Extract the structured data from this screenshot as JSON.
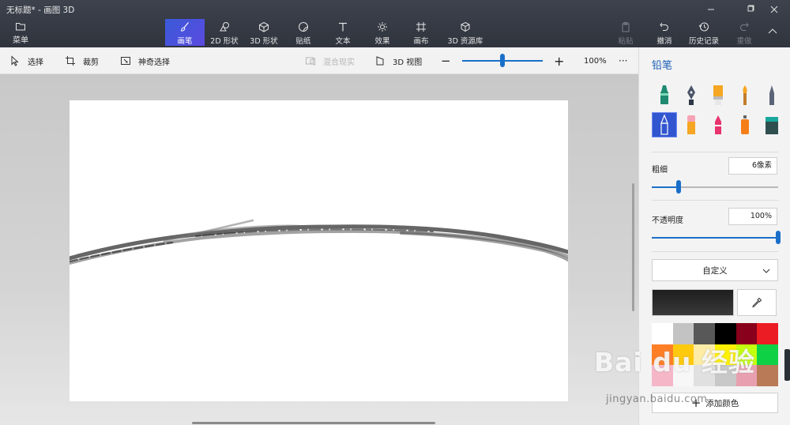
{
  "window": {
    "title": "无标题* - 画图 3D",
    "controls": {
      "minimize": "—",
      "restore": "▫",
      "close": "✕"
    }
  },
  "menu": {
    "label": "菜单",
    "icon": "folder-icon"
  },
  "tools": [
    {
      "label": "画笔",
      "icon": "brush-icon",
      "active": true
    },
    {
      "label": "2D 形状",
      "icon": "2d-shapes-icon",
      "active": false
    },
    {
      "label": "3D 形状",
      "icon": "3d-shapes-icon",
      "active": false
    },
    {
      "label": "贴纸",
      "icon": "sticker-icon",
      "active": false
    },
    {
      "label": "文本",
      "icon": "text-icon",
      "active": false
    },
    {
      "label": "效果",
      "icon": "effects-icon",
      "active": false
    },
    {
      "label": "画布",
      "icon": "canvas-icon",
      "active": false
    },
    {
      "label": "3D 资源库",
      "icon": "3d-library-icon",
      "active": false
    }
  ],
  "history": {
    "paste": {
      "label": "粘贴",
      "enabled": false
    },
    "undo": {
      "label": "撤消",
      "enabled": true
    },
    "history": {
      "label": "历史记录",
      "enabled": true
    },
    "redo": {
      "label": "重做",
      "enabled": false
    }
  },
  "toolbar2": {
    "select": "选择",
    "crop": "裁剪",
    "magic_select": "神奇选择",
    "mixed_reality": "混合现实",
    "view3d": "3D 视图",
    "zoom_out": "−",
    "zoom_in": "+",
    "zoom_level": "100%",
    "zoom_fraction": 0.5,
    "more": "···"
  },
  "panel": {
    "title": "铅笔",
    "brushes": [
      {
        "name": "marker",
        "selected": false
      },
      {
        "name": "calligraphy-pen",
        "selected": false
      },
      {
        "name": "oil-brush",
        "selected": false
      },
      {
        "name": "watercolor",
        "selected": false
      },
      {
        "name": "pixel-pen",
        "selected": false
      },
      {
        "name": "pencil",
        "selected": true
      },
      {
        "name": "eraser",
        "selected": false
      },
      {
        "name": "crayon",
        "selected": false
      },
      {
        "name": "spray-can",
        "selected": false
      },
      {
        "name": "fill-bucket",
        "selected": false
      }
    ],
    "thickness_label": "粗细",
    "thickness_value": "6像素",
    "thickness_fraction": 0.21,
    "opacity_label": "不透明度",
    "opacity_value": "100%",
    "opacity_fraction": 1.0,
    "color_mode": "自定义",
    "add_color": "添加颜色",
    "palette": [
      "#ffffff",
      "#c3c3c3",
      "#585858",
      "#000000",
      "#88001b",
      "#ec1c24",
      "#ff7f27",
      "#ffc90e",
      "#fdeca6",
      "#fff200",
      "#c4ff0e",
      "#0ed145",
      "#f5b6c8",
      "#f7f7f7",
      "#e0e0e0",
      "#c8c8c8",
      "#e8a0b0",
      "#b97a57"
    ]
  },
  "watermark": {
    "main": "Bai du 经验",
    "sub": "jingyan.baidu.com"
  },
  "accent_color": "#1a6fc9"
}
